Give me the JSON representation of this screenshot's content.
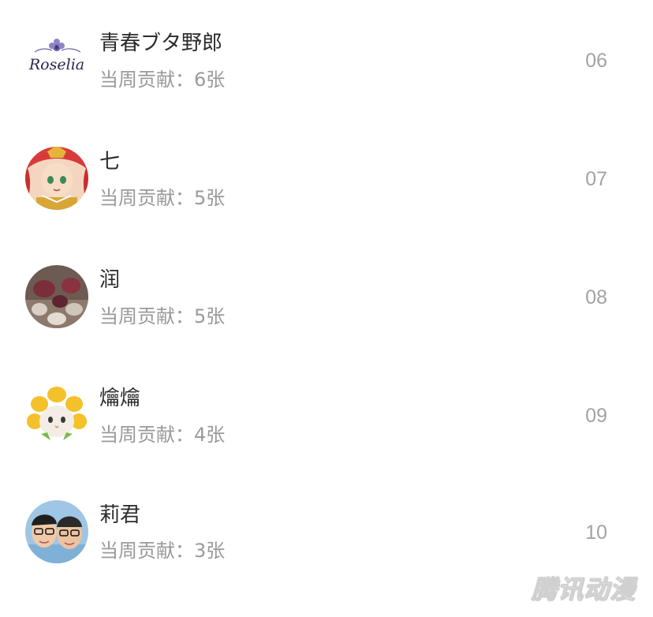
{
  "ranking": [
    {
      "name": "青春ブタ野郎",
      "contribution": "当周贡献：6张",
      "rank": "06",
      "avatar": "roselia-logo"
    },
    {
      "name": "七",
      "contribution": "当周贡献：5张",
      "rank": "07",
      "avatar": "anime-girl-red-hair"
    },
    {
      "name": "润",
      "contribution": "当周贡献：5张",
      "rank": "08",
      "avatar": "photo-beans"
    },
    {
      "name": "爚爚",
      "contribution": "当周贡献：4张",
      "rank": "09",
      "avatar": "cat-in-flower-hat"
    },
    {
      "name": "莉君",
      "contribution": "当周贡献：3张",
      "rank": "10",
      "avatar": "couple-with-glasses"
    }
  ],
  "logo_text": "Roselia",
  "watermark": "腾讯动漫"
}
